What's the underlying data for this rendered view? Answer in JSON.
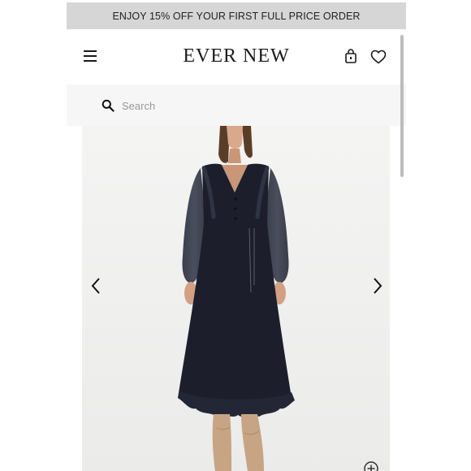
{
  "promo_banner": {
    "text": "ENJOY 15% OFF YOUR FIRST FULL PRICE ORDER"
  },
  "header": {
    "brand": "EVER NEW",
    "icons": [
      "menu-icon",
      "shopping-bag-icon",
      "heart-icon"
    ]
  },
  "search": {
    "placeholder": "Search",
    "value": "",
    "icon": "search-icon"
  },
  "gallery": {
    "image": "product-photo",
    "controls": [
      "chevron-left-icon",
      "chevron-right-icon",
      "zoom-plus-icon"
    ]
  },
  "colors": {
    "promo_bg": "#d6d6d6",
    "search_bg": "#f6f6f6",
    "gallery_bg": "#f3f3f2",
    "text": "#1a1a1a",
    "dress": "#1c1f2b"
  }
}
